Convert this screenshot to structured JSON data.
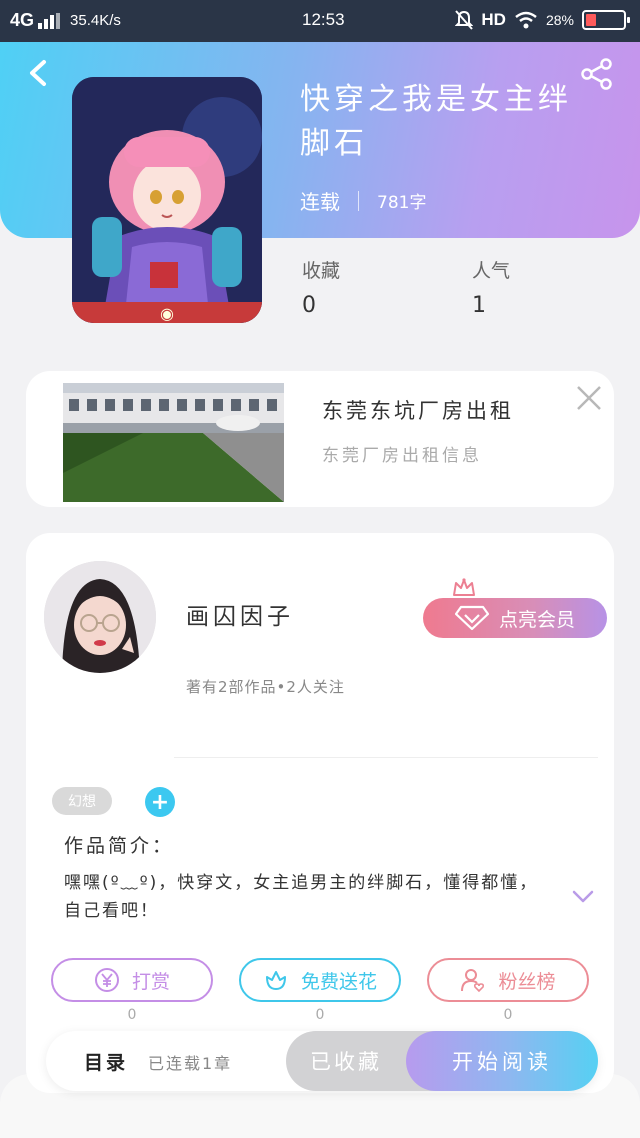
{
  "status_bar": {
    "network": "4G",
    "speed": "35.4K/s",
    "time": "12:53",
    "hd": "HD",
    "battery_percent": "28%",
    "battery_level": 0.28
  },
  "book": {
    "title": "快穿之我是女主绊脚石",
    "status": "连载",
    "word_count": "781字",
    "collect_label": "收藏",
    "collect_value": "0",
    "popularity_label": "人气",
    "popularity_value": "1"
  },
  "ad": {
    "title": "东莞东坑厂房出租",
    "subtitle": "东莞厂房出租信息"
  },
  "author": {
    "name": "画囚因子",
    "stats": "著有2部作品•2人关注",
    "vip_button": "点亮会员"
  },
  "tags": [
    "幻想"
  ],
  "intro": {
    "label": "作品简介：",
    "text": "嘿嘿(º﹏º)，快穿文，女主追男主的绊脚石，懂得都懂，自己看吧！"
  },
  "actions": [
    {
      "label": "打赏",
      "count": "0",
      "icon": "yen-icon",
      "color": "#c48ee6"
    },
    {
      "label": "免费送花",
      "count": "0",
      "icon": "flower-icon",
      "color": "#3fc7ea"
    },
    {
      "label": "粉丝榜",
      "count": "0",
      "icon": "fan-user-icon",
      "color": "#ec8d96"
    }
  ],
  "bottom": {
    "toc_label": "目录",
    "toc_status": "已连载1章",
    "collected": "已收藏",
    "read": "开始阅读"
  }
}
